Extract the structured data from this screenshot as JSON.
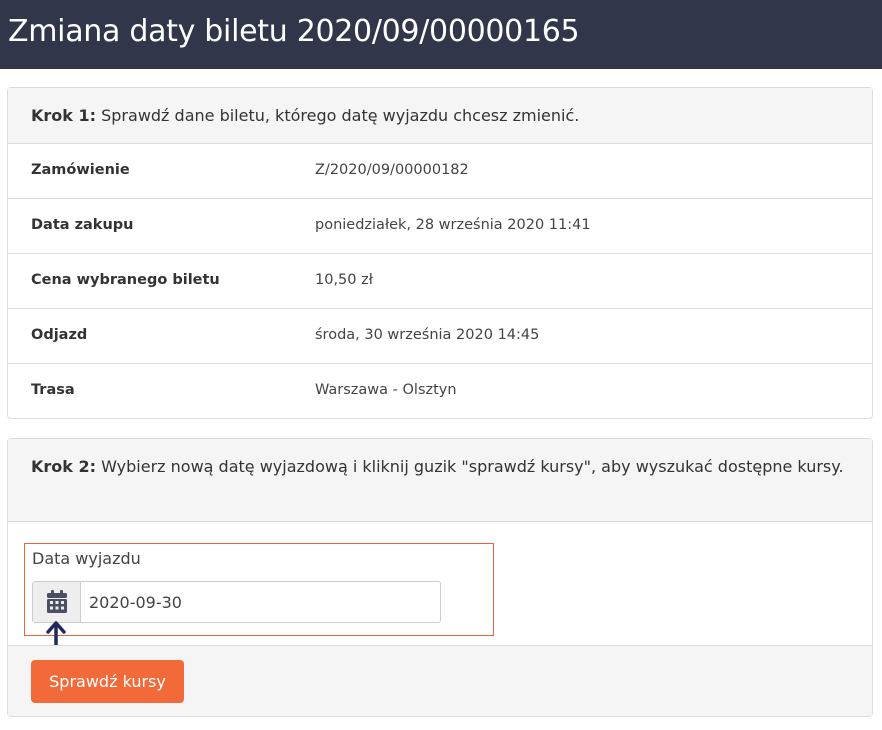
{
  "page": {
    "title": "Zmiana daty biletu 2020/09/00000165"
  },
  "step1": {
    "label": "Krok 1:",
    "text": " Sprawdź dane biletu, którego datę wyjazdu chcesz zmienić.",
    "rows": [
      {
        "label": "Zamówienie",
        "value": "Z/2020/09/00000182"
      },
      {
        "label": "Data zakupu",
        "value": "poniedziałek, 28 września 2020 11:41"
      },
      {
        "label": "Cena wybranego biletu",
        "value": "10,50 zł"
      },
      {
        "label": "Odjazd",
        "value": "środa, 30 września 2020 14:45"
      },
      {
        "label": "Trasa",
        "value": "Warszawa - Olsztyn"
      }
    ]
  },
  "step2": {
    "label": "Krok 2:",
    "text": " Wybierz nową datę wyjazdową i kliknij guzik \"sprawdź kursy\", aby wyszukać dostępne kursy.",
    "field_label": "Data wyjazdu",
    "date_value": "2020-09-30",
    "calendar_icon": "calendar-icon",
    "button_label": "Sprawdź kursy"
  },
  "colors": {
    "header_bg": "#32364a",
    "accent": "#f26a3a",
    "highlight_border": "#e8643c",
    "arrow": "#1f2a5a"
  }
}
